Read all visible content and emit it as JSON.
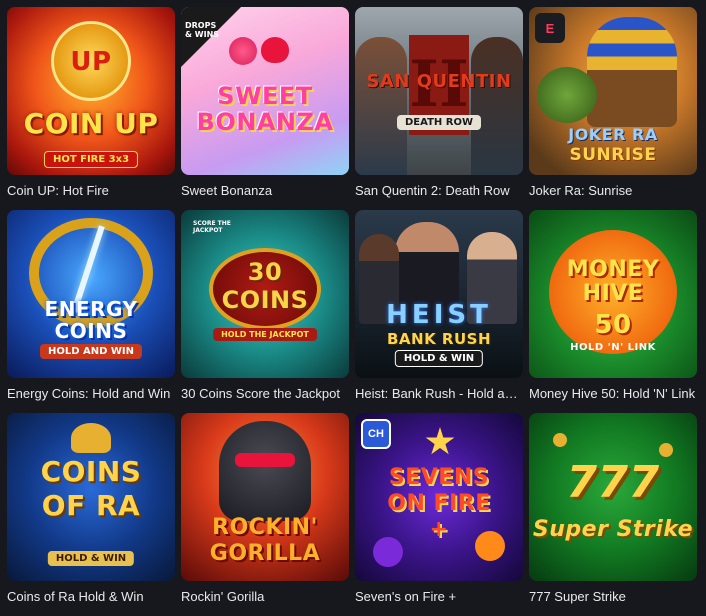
{
  "games": [
    {
      "title": "Coin UP: Hot Fire",
      "art_text": "COIN UP",
      "art_sub": "HOT FIRE 3x3",
      "badge": "UP"
    },
    {
      "title": "Sweet Bonanza",
      "art_text": "SWEET BONANZA",
      "art_sub": "DROPS & WINS"
    },
    {
      "title": "San Quentin 2: Death Row",
      "art_text": "SAN QUENTIN",
      "art_sub": "DEATH ROW",
      "badge": "II"
    },
    {
      "title": "Joker Ra: Sunrise",
      "art_text": "JOKER RA",
      "art_sub": "SUNRISE",
      "badge": "E"
    },
    {
      "title": "Energy Coins: Hold and Win",
      "art_text": "ENERGY COINS",
      "art_sub": "HOLD AND WIN"
    },
    {
      "title": "30 Coins Score the Jackpot",
      "art_text": "30 COINS",
      "art_sub": "HOLD THE JACKPOT",
      "badge": "SCORE THE JACKPOT"
    },
    {
      "title": "Heist: Bank Rush - Hold and Win",
      "art_text": "HEIST",
      "art_sub": "BANK RUSH",
      "art_sub2": "HOLD & WIN"
    },
    {
      "title": "Money Hive 50: Hold 'N' Link",
      "art_text": "MONEY HIVE",
      "art_sub": "50",
      "art_sub2": "HOLD 'N' LINK"
    },
    {
      "title": "Coins of Ra Hold & Win",
      "art_text": "COINS OF RA",
      "art_sub": "HOLD & WIN"
    },
    {
      "title": "Rockin' Gorilla",
      "art_text": "ROCKIN' GORILLA"
    },
    {
      "title": "Seven's on Fire +",
      "art_text": "SEVENS ON FIRE +",
      "badge": "CH"
    },
    {
      "title": "777 Super Strike",
      "art_text": "777",
      "art_sub": "Super Strike"
    }
  ],
  "colors": {
    "background": "#17181d",
    "label": "#e9e9ec"
  }
}
